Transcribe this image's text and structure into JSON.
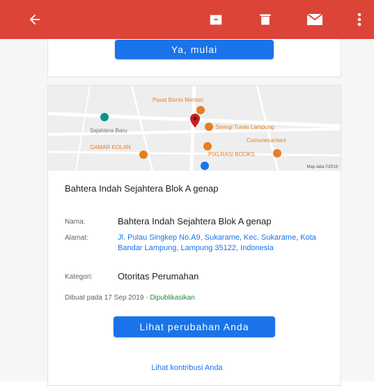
{
  "appbar": {
    "color": "#db4437",
    "icons": [
      "back-arrow-icon",
      "archive-icon",
      "delete-icon",
      "mail-icon",
      "more-vert-icon"
    ]
  },
  "start_button": "Ya, mulai",
  "map": {
    "labels": [
      "Pusat Bisnis Mentari",
      "Sejahtera Baru",
      "GAMAR KOLAN",
      "Sinergi Tunas Lampung",
      "Comunecantant",
      "PIXLRASI BOOKS"
    ],
    "copyright": "Map data ©2019"
  },
  "place": {
    "title": "Bahtera Indah Sejahtera Blok A genap",
    "name_label": "Nama:",
    "name_value": "Bahtera Indah Sejahtera Blok A genap",
    "address_label": "Alamat:",
    "address_value": "Jl. Pulau Singkep No.A9, Sukarame, Kec. Sukarame, Kota Bandar Lampung, Lampung 35122, Indonesia",
    "category_label": "Kategori:",
    "category_value": "Otoritas Perumahan",
    "created_prefix": "Dibuat pada 17 Sep 2019 · ",
    "created_status": "Dipublikasikan"
  },
  "view_changes_button": "Lihat perubahan Anda",
  "view_contributions_link": "Lihat kontribusi Anda",
  "colors": {
    "accent": "#1a73e8",
    "published": "#1e8e3e"
  }
}
